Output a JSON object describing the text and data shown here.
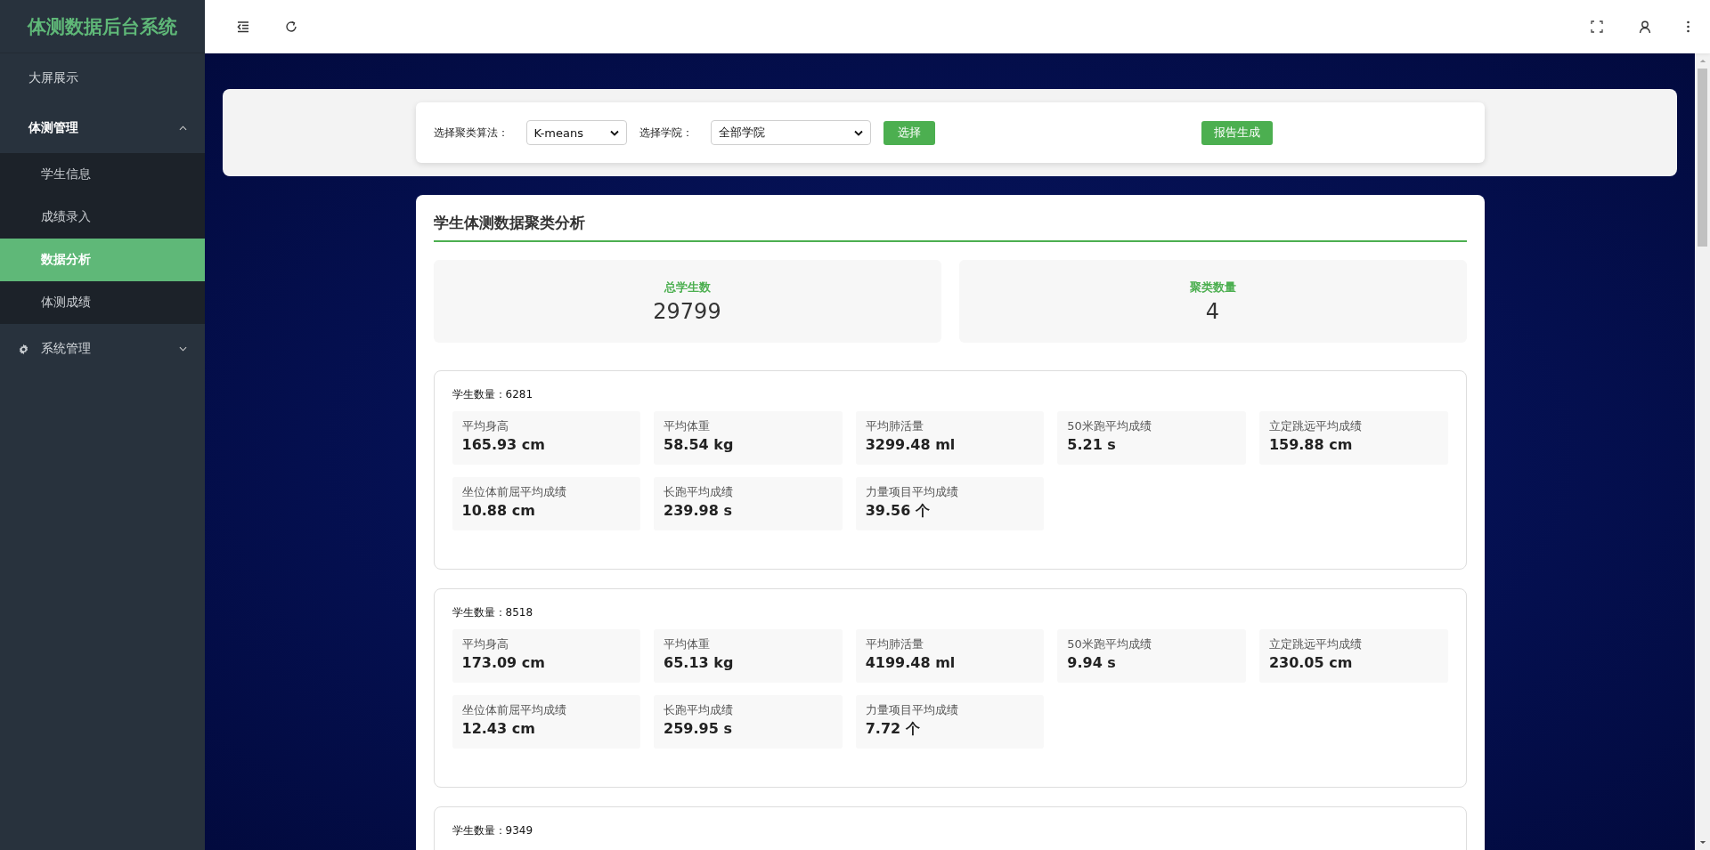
{
  "sidebar": {
    "logo": "体测数据后台系统",
    "menu": [
      {
        "label": "大屏展示",
        "kind": "item",
        "selected": false
      },
      {
        "label": "体测管理",
        "kind": "group",
        "expanded": true,
        "children": [
          {
            "label": "学生信息",
            "selected": false
          },
          {
            "label": "成绩录入",
            "selected": false
          },
          {
            "label": "数据分析",
            "selected": true
          },
          {
            "label": "体测成绩",
            "selected": false
          }
        ]
      },
      {
        "label": "系统管理",
        "kind": "settings",
        "expanded": false
      }
    ]
  },
  "filters": {
    "algorithm": {
      "label": "选择聚类算法：",
      "value": "K-means"
    },
    "college": {
      "label": "选择学院：",
      "value": "全部学院"
    },
    "buttons": [
      {
        "label": "选择",
        "kind": "select"
      },
      {
        "label": "报告生成",
        "kind": "report"
      }
    ]
  },
  "analysis": {
    "title": "学生体测数据聚类分析",
    "stats": [
      {
        "label": "总学生数",
        "value": "29799"
      },
      {
        "label": "聚类数量",
        "value": "4"
      }
    ],
    "clusters": [
      {
        "count_label": "学生数量：6281",
        "metrics": [
          {
            "label": "平均身高",
            "value": "165.93 cm"
          },
          {
            "label": "平均体重",
            "value": "58.54 kg"
          },
          {
            "label": "平均肺活量",
            "value": "3299.48 ml"
          },
          {
            "label": "50米跑平均成绩",
            "value": "5.21 s"
          },
          {
            "label": "立定跳远平均成绩",
            "value": "159.88 cm"
          },
          {
            "label": "坐位体前屈平均成绩",
            "value": "10.88 cm"
          },
          {
            "label": "长跑平均成绩",
            "value": "239.98 s"
          },
          {
            "label": "力量项目平均成绩",
            "value": "39.56 个"
          }
        ]
      },
      {
        "count_label": "学生数量：8518",
        "metrics": [
          {
            "label": "平均身高",
            "value": "173.09 cm"
          },
          {
            "label": "平均体重",
            "value": "65.13 kg"
          },
          {
            "label": "平均肺活量",
            "value": "4199.48 ml"
          },
          {
            "label": "50米跑平均成绩",
            "value": "9.94 s"
          },
          {
            "label": "立定跳远平均成绩",
            "value": "230.05 cm"
          },
          {
            "label": "坐位体前屈平均成绩",
            "value": "12.43 cm"
          },
          {
            "label": "长跑平均成绩",
            "value": "259.95 s"
          },
          {
            "label": "力量项目平均成绩",
            "value": "7.72 个"
          }
        ]
      },
      {
        "count_label": "学生数量：9349"
      }
    ]
  }
}
